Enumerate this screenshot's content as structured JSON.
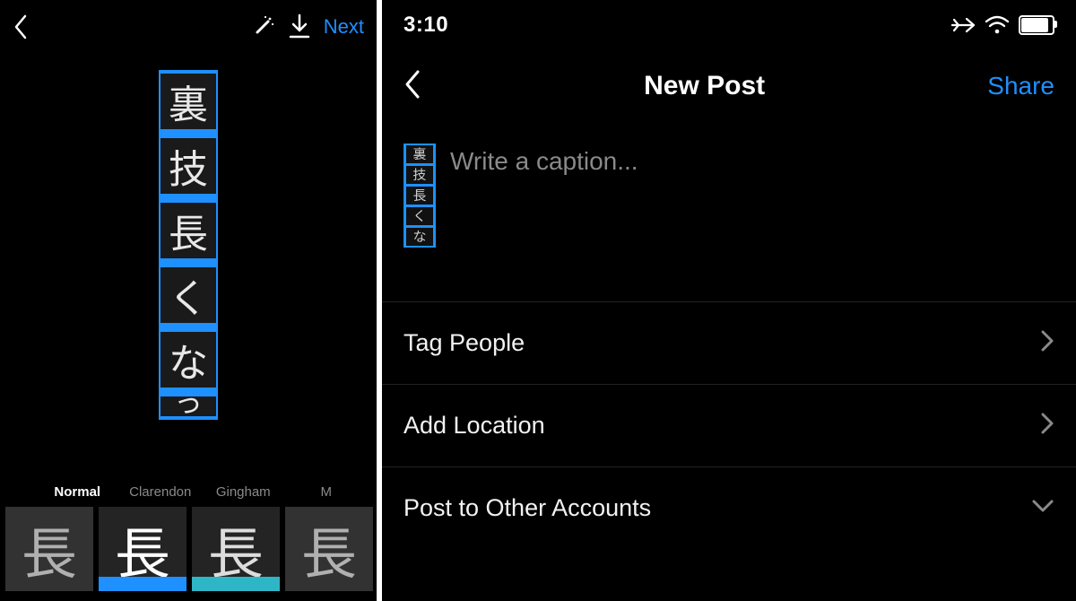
{
  "left": {
    "next": "Next",
    "kanji": [
      "裏",
      "技",
      "長",
      "く",
      "な"
    ],
    "partial": "っ",
    "filters": {
      "normal": "Normal",
      "clarendon": "Clarendon",
      "gingham": "Gingham",
      "cut": "M"
    },
    "thumb_glyph": "長"
  },
  "right": {
    "time": "3:10",
    "title": "New Post",
    "share": "Share",
    "caption_placeholder": "Write a caption...",
    "thumb_chars": [
      "裏",
      "技",
      "長",
      "く",
      "な"
    ],
    "rows": {
      "tag": "Tag People",
      "loc": "Add Location",
      "post": "Post to Other Accounts"
    }
  }
}
